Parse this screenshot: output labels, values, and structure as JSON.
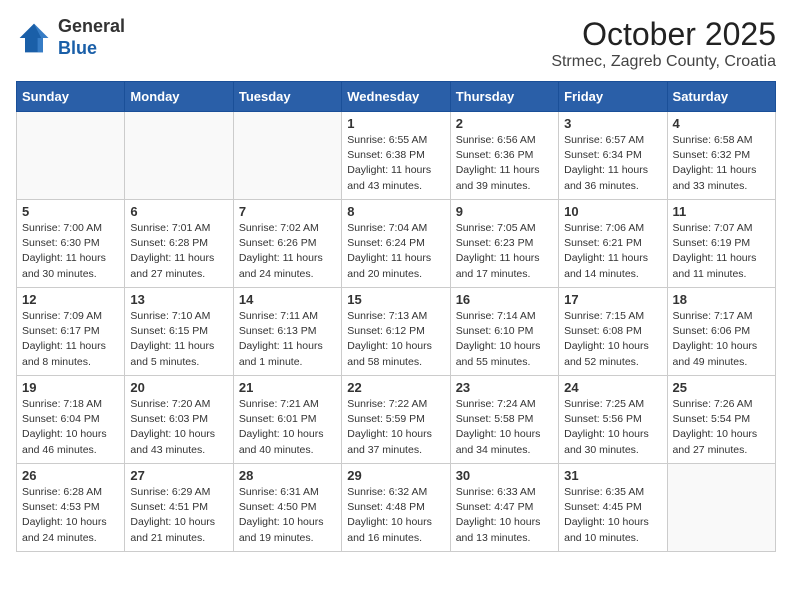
{
  "header": {
    "logo_general": "General",
    "logo_blue": "Blue",
    "month": "October 2025",
    "location": "Strmec, Zagreb County, Croatia"
  },
  "weekdays": [
    "Sunday",
    "Monday",
    "Tuesday",
    "Wednesday",
    "Thursday",
    "Friday",
    "Saturday"
  ],
  "weeks": [
    [
      {
        "day": "",
        "info": ""
      },
      {
        "day": "",
        "info": ""
      },
      {
        "day": "",
        "info": ""
      },
      {
        "day": "1",
        "info": "Sunrise: 6:55 AM\nSunset: 6:38 PM\nDaylight: 11 hours\nand 43 minutes."
      },
      {
        "day": "2",
        "info": "Sunrise: 6:56 AM\nSunset: 6:36 PM\nDaylight: 11 hours\nand 39 minutes."
      },
      {
        "day": "3",
        "info": "Sunrise: 6:57 AM\nSunset: 6:34 PM\nDaylight: 11 hours\nand 36 minutes."
      },
      {
        "day": "4",
        "info": "Sunrise: 6:58 AM\nSunset: 6:32 PM\nDaylight: 11 hours\nand 33 minutes."
      }
    ],
    [
      {
        "day": "5",
        "info": "Sunrise: 7:00 AM\nSunset: 6:30 PM\nDaylight: 11 hours\nand 30 minutes."
      },
      {
        "day": "6",
        "info": "Sunrise: 7:01 AM\nSunset: 6:28 PM\nDaylight: 11 hours\nand 27 minutes."
      },
      {
        "day": "7",
        "info": "Sunrise: 7:02 AM\nSunset: 6:26 PM\nDaylight: 11 hours\nand 24 minutes."
      },
      {
        "day": "8",
        "info": "Sunrise: 7:04 AM\nSunset: 6:24 PM\nDaylight: 11 hours\nand 20 minutes."
      },
      {
        "day": "9",
        "info": "Sunrise: 7:05 AM\nSunset: 6:23 PM\nDaylight: 11 hours\nand 17 minutes."
      },
      {
        "day": "10",
        "info": "Sunrise: 7:06 AM\nSunset: 6:21 PM\nDaylight: 11 hours\nand 14 minutes."
      },
      {
        "day": "11",
        "info": "Sunrise: 7:07 AM\nSunset: 6:19 PM\nDaylight: 11 hours\nand 11 minutes."
      }
    ],
    [
      {
        "day": "12",
        "info": "Sunrise: 7:09 AM\nSunset: 6:17 PM\nDaylight: 11 hours\nand 8 minutes."
      },
      {
        "day": "13",
        "info": "Sunrise: 7:10 AM\nSunset: 6:15 PM\nDaylight: 11 hours\nand 5 minutes."
      },
      {
        "day": "14",
        "info": "Sunrise: 7:11 AM\nSunset: 6:13 PM\nDaylight: 11 hours\nand 1 minute."
      },
      {
        "day": "15",
        "info": "Sunrise: 7:13 AM\nSunset: 6:12 PM\nDaylight: 10 hours\nand 58 minutes."
      },
      {
        "day": "16",
        "info": "Sunrise: 7:14 AM\nSunset: 6:10 PM\nDaylight: 10 hours\nand 55 minutes."
      },
      {
        "day": "17",
        "info": "Sunrise: 7:15 AM\nSunset: 6:08 PM\nDaylight: 10 hours\nand 52 minutes."
      },
      {
        "day": "18",
        "info": "Sunrise: 7:17 AM\nSunset: 6:06 PM\nDaylight: 10 hours\nand 49 minutes."
      }
    ],
    [
      {
        "day": "19",
        "info": "Sunrise: 7:18 AM\nSunset: 6:04 PM\nDaylight: 10 hours\nand 46 minutes."
      },
      {
        "day": "20",
        "info": "Sunrise: 7:20 AM\nSunset: 6:03 PM\nDaylight: 10 hours\nand 43 minutes."
      },
      {
        "day": "21",
        "info": "Sunrise: 7:21 AM\nSunset: 6:01 PM\nDaylight: 10 hours\nand 40 minutes."
      },
      {
        "day": "22",
        "info": "Sunrise: 7:22 AM\nSunset: 5:59 PM\nDaylight: 10 hours\nand 37 minutes."
      },
      {
        "day": "23",
        "info": "Sunrise: 7:24 AM\nSunset: 5:58 PM\nDaylight: 10 hours\nand 34 minutes."
      },
      {
        "day": "24",
        "info": "Sunrise: 7:25 AM\nSunset: 5:56 PM\nDaylight: 10 hours\nand 30 minutes."
      },
      {
        "day": "25",
        "info": "Sunrise: 7:26 AM\nSunset: 5:54 PM\nDaylight: 10 hours\nand 27 minutes."
      }
    ],
    [
      {
        "day": "26",
        "info": "Sunrise: 6:28 AM\nSunset: 4:53 PM\nDaylight: 10 hours\nand 24 minutes."
      },
      {
        "day": "27",
        "info": "Sunrise: 6:29 AM\nSunset: 4:51 PM\nDaylight: 10 hours\nand 21 minutes."
      },
      {
        "day": "28",
        "info": "Sunrise: 6:31 AM\nSunset: 4:50 PM\nDaylight: 10 hours\nand 19 minutes."
      },
      {
        "day": "29",
        "info": "Sunrise: 6:32 AM\nSunset: 4:48 PM\nDaylight: 10 hours\nand 16 minutes."
      },
      {
        "day": "30",
        "info": "Sunrise: 6:33 AM\nSunset: 4:47 PM\nDaylight: 10 hours\nand 13 minutes."
      },
      {
        "day": "31",
        "info": "Sunrise: 6:35 AM\nSunset: 4:45 PM\nDaylight: 10 hours\nand 10 minutes."
      },
      {
        "day": "",
        "info": ""
      }
    ]
  ]
}
